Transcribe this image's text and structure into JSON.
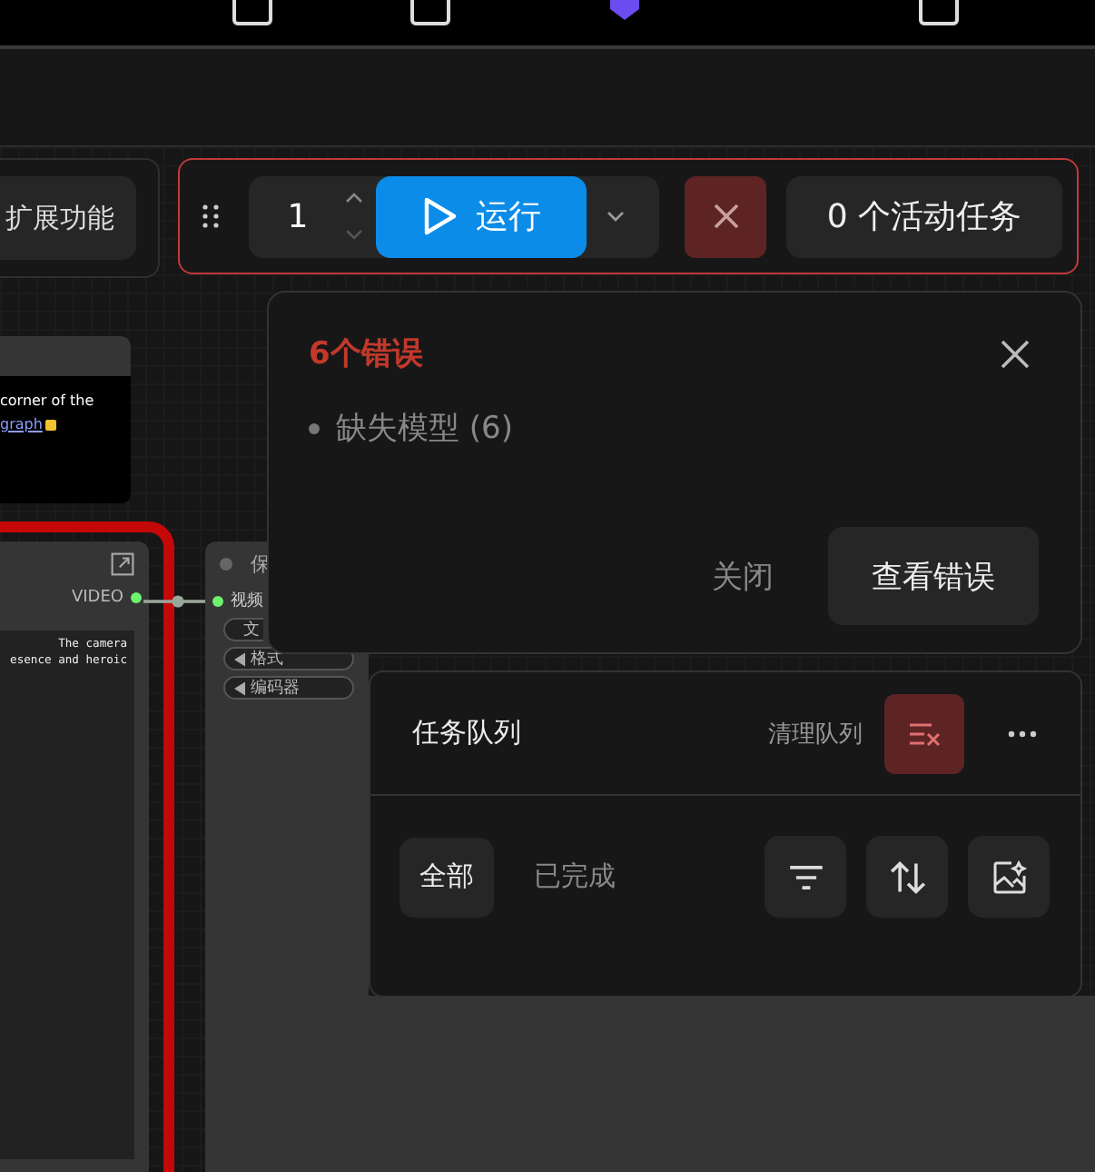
{
  "toolbar": {
    "extensions_button": "扩展功能"
  },
  "run_bar": {
    "batch_count": "1",
    "run_button": "运行",
    "active_tasks": "0 个活动任务"
  },
  "error_dialog": {
    "title": "6个错误",
    "items": [
      "缺失模型 (6)"
    ],
    "buttons": [
      {
        "label": "关闭",
        "primary": false
      },
      {
        "label": "查看错误",
        "primary": true
      }
    ]
  },
  "queue_panel": {
    "title": "任务队列",
    "clear_label": "清理队列",
    "filters": [
      {
        "label": "全部",
        "selected": true
      },
      {
        "label": "已完成",
        "selected": false
      }
    ]
  },
  "canvas": {
    "note": {
      "lines": [
        "corner of the"
      ],
      "link": "graph"
    },
    "video_node": {
      "output": "VIDEO",
      "text_lines": [
        "The camera",
        "esence and heroic"
      ]
    },
    "save_node": {
      "title": "保",
      "input": "视频",
      "widgets": [
        {
          "label": "文",
          "kind": "text"
        },
        {
          "label": "格式",
          "kind": "combo"
        },
        {
          "label": "编码器",
          "kind": "combo"
        }
      ]
    }
  }
}
